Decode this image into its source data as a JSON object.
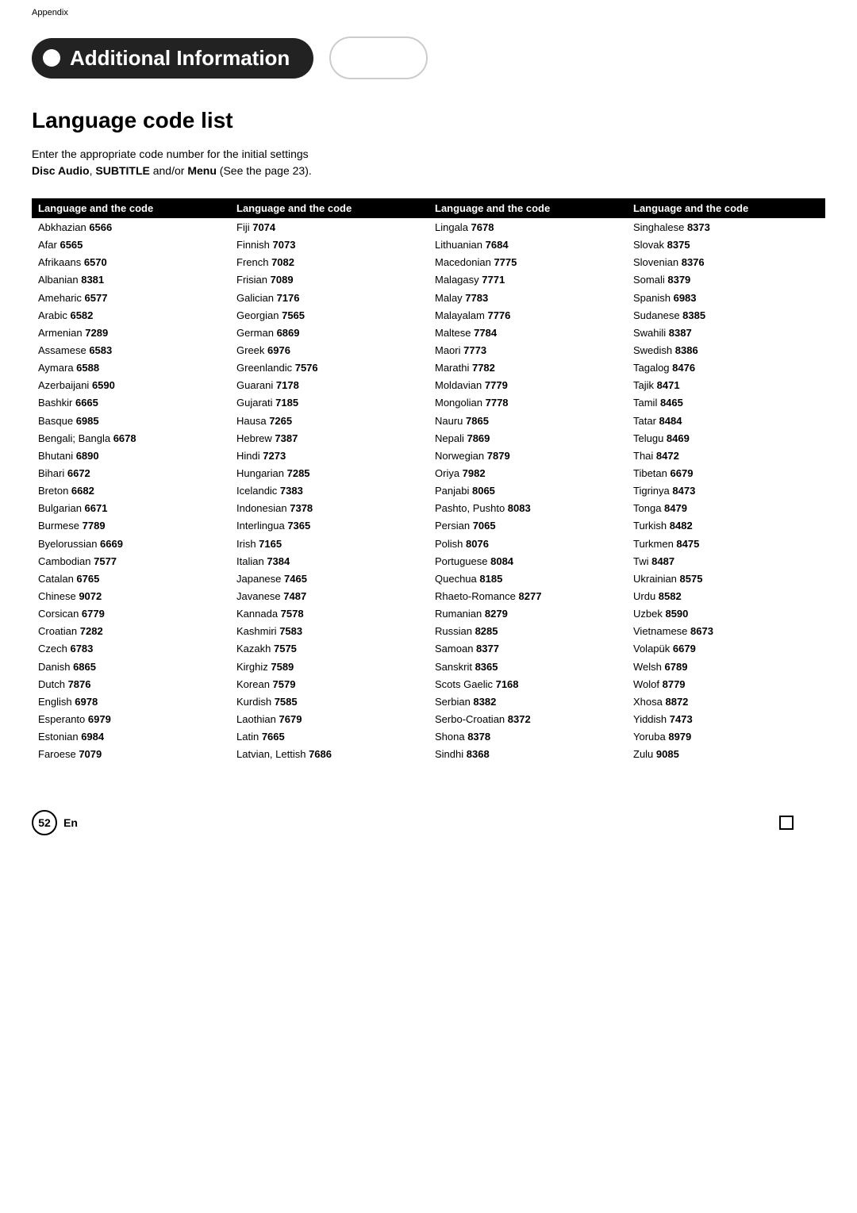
{
  "header": {
    "appendix": "Appendix",
    "title": "Additional Information",
    "page_num": "52",
    "en": "En"
  },
  "page_title": "Language code list",
  "description": "Enter the appropriate code number for the initial settings Disc Audio, SUBTITLE and/or Menu (See the page 23).",
  "table_header": "Language and the code",
  "columns": [
    [
      {
        "lang": "Abkhazian",
        "code": "6566"
      },
      {
        "lang": "Afar",
        "code": "6565"
      },
      {
        "lang": "Afrikaans",
        "code": "6570"
      },
      {
        "lang": "Albanian",
        "code": "8381"
      },
      {
        "lang": "Ameharic",
        "code": "6577"
      },
      {
        "lang": "Arabic",
        "code": "6582"
      },
      {
        "lang": "Armenian",
        "code": "7289"
      },
      {
        "lang": "Assamese",
        "code": "6583"
      },
      {
        "lang": "Aymara",
        "code": "6588"
      },
      {
        "lang": "Azerbaijani",
        "code": "6590"
      },
      {
        "lang": "Bashkir",
        "code": "6665"
      },
      {
        "lang": "Basque",
        "code": "6985"
      },
      {
        "lang": "Bengali; Bangla",
        "code": "6678"
      },
      {
        "lang": "Bhutani",
        "code": "6890"
      },
      {
        "lang": "Bihari",
        "code": "6672"
      },
      {
        "lang": "Breton",
        "code": "6682"
      },
      {
        "lang": "Bulgarian",
        "code": "6671"
      },
      {
        "lang": "Burmese",
        "code": "7789"
      },
      {
        "lang": "Byelorussian",
        "code": "6669"
      },
      {
        "lang": "Cambodian",
        "code": "7577"
      },
      {
        "lang": "Catalan",
        "code": "6765"
      },
      {
        "lang": "Chinese",
        "code": "9072"
      },
      {
        "lang": "Corsican",
        "code": "6779"
      },
      {
        "lang": "Croatian",
        "code": "7282"
      },
      {
        "lang": "Czech",
        "code": "6783"
      },
      {
        "lang": "Danish",
        "code": "6865"
      },
      {
        "lang": "Dutch",
        "code": "7876"
      },
      {
        "lang": "English",
        "code": "6978"
      },
      {
        "lang": "Esperanto",
        "code": "6979"
      },
      {
        "lang": "Estonian",
        "code": "6984"
      },
      {
        "lang": "Faroese",
        "code": "7079"
      }
    ],
    [
      {
        "lang": "Fiji",
        "code": "7074"
      },
      {
        "lang": "Finnish",
        "code": "7073"
      },
      {
        "lang": "French",
        "code": "7082"
      },
      {
        "lang": "Frisian",
        "code": "7089"
      },
      {
        "lang": "Galician",
        "code": "7176"
      },
      {
        "lang": "Georgian",
        "code": "7565"
      },
      {
        "lang": "German",
        "code": "6869"
      },
      {
        "lang": "Greek",
        "code": "6976"
      },
      {
        "lang": "Greenlandic",
        "code": "7576"
      },
      {
        "lang": "Guarani",
        "code": "7178"
      },
      {
        "lang": "Gujarati",
        "code": "7185"
      },
      {
        "lang": "Hausa",
        "code": "7265"
      },
      {
        "lang": "Hebrew",
        "code": "7387"
      },
      {
        "lang": "Hindi",
        "code": "7273"
      },
      {
        "lang": "Hungarian",
        "code": "7285"
      },
      {
        "lang": "Icelandic",
        "code": "7383"
      },
      {
        "lang": "Indonesian",
        "code": "7378"
      },
      {
        "lang": "Interlingua",
        "code": "7365"
      },
      {
        "lang": "Irish",
        "code": "7165"
      },
      {
        "lang": "Italian",
        "code": "7384"
      },
      {
        "lang": "Japanese",
        "code": "7465"
      },
      {
        "lang": "Javanese",
        "code": "7487"
      },
      {
        "lang": "Kannada",
        "code": "7578"
      },
      {
        "lang": "Kashmiri",
        "code": "7583"
      },
      {
        "lang": "Kazakh",
        "code": "7575"
      },
      {
        "lang": "Kirghiz",
        "code": "7589"
      },
      {
        "lang": "Korean",
        "code": "7579"
      },
      {
        "lang": "Kurdish",
        "code": "7585"
      },
      {
        "lang": "Laothian",
        "code": "7679"
      },
      {
        "lang": "Latin",
        "code": "7665"
      },
      {
        "lang": "Latvian, Lettish",
        "code": "7686"
      }
    ],
    [
      {
        "lang": "Lingala",
        "code": "7678"
      },
      {
        "lang": "Lithuanian",
        "code": "7684"
      },
      {
        "lang": "Macedonian",
        "code": "7775"
      },
      {
        "lang": "Malagasy",
        "code": "7771"
      },
      {
        "lang": "Malay",
        "code": "7783"
      },
      {
        "lang": "Malayalam",
        "code": "7776"
      },
      {
        "lang": "Maltese",
        "code": "7784"
      },
      {
        "lang": "Maori",
        "code": "7773"
      },
      {
        "lang": "Marathi",
        "code": "7782"
      },
      {
        "lang": "Moldavian",
        "code": "7779"
      },
      {
        "lang": "Mongolian",
        "code": "7778"
      },
      {
        "lang": "Nauru",
        "code": "7865"
      },
      {
        "lang": "Nepali",
        "code": "7869"
      },
      {
        "lang": "Norwegian",
        "code": "7879"
      },
      {
        "lang": "Oriya",
        "code": "7982"
      },
      {
        "lang": "Panjabi",
        "code": "8065"
      },
      {
        "lang": "Pashto, Pushto",
        "code": "8083"
      },
      {
        "lang": "Persian",
        "code": "7065"
      },
      {
        "lang": "Polish",
        "code": "8076"
      },
      {
        "lang": "Portuguese",
        "code": "8084"
      },
      {
        "lang": "Quechua",
        "code": "8185"
      },
      {
        "lang": "Rhaeto-Romance",
        "code": "8277"
      },
      {
        "lang": "Rumanian",
        "code": "8279"
      },
      {
        "lang": "Russian",
        "code": "8285"
      },
      {
        "lang": "Samoan",
        "code": "8377"
      },
      {
        "lang": "Sanskrit",
        "code": "8365"
      },
      {
        "lang": "Scots Gaelic",
        "code": "7168"
      },
      {
        "lang": "Serbian",
        "code": "8382"
      },
      {
        "lang": "Serbo-Croatian",
        "code": "8372"
      },
      {
        "lang": "Shona",
        "code": "8378"
      },
      {
        "lang": "Sindhi",
        "code": "8368"
      }
    ],
    [
      {
        "lang": "Singhalese",
        "code": "8373"
      },
      {
        "lang": "Slovak",
        "code": "8375"
      },
      {
        "lang": "Slovenian",
        "code": "8376"
      },
      {
        "lang": "Somali",
        "code": "8379"
      },
      {
        "lang": "Spanish",
        "code": "6983"
      },
      {
        "lang": "Sudanese",
        "code": "8385"
      },
      {
        "lang": "Swahili",
        "code": "8387"
      },
      {
        "lang": "Swedish",
        "code": "8386"
      },
      {
        "lang": "Tagalog",
        "code": "8476"
      },
      {
        "lang": "Tajik",
        "code": "8471"
      },
      {
        "lang": "Tamil",
        "code": "8465"
      },
      {
        "lang": "Tatar",
        "code": "8484"
      },
      {
        "lang": "Telugu",
        "code": "8469"
      },
      {
        "lang": "Thai",
        "code": "8472"
      },
      {
        "lang": "Tibetan",
        "code": "6679"
      },
      {
        "lang": "Tigrinya",
        "code": "8473"
      },
      {
        "lang": "Tonga",
        "code": "8479"
      },
      {
        "lang": "Turkish",
        "code": "8482"
      },
      {
        "lang": "Turkmen",
        "code": "8475"
      },
      {
        "lang": "Twi",
        "code": "8487"
      },
      {
        "lang": "Ukrainian",
        "code": "8575"
      },
      {
        "lang": "Urdu",
        "code": "8582"
      },
      {
        "lang": "Uzbek",
        "code": "8590"
      },
      {
        "lang": "Vietnamese",
        "code": "8673"
      },
      {
        "lang": "Volapük",
        "code": "6679"
      },
      {
        "lang": "Welsh",
        "code": "6789"
      },
      {
        "lang": "Wolof",
        "code": "8779"
      },
      {
        "lang": "Xhosa",
        "code": "8872"
      },
      {
        "lang": "Yiddish",
        "code": "7473"
      },
      {
        "lang": "Yoruba",
        "code": "8979"
      },
      {
        "lang": "Zulu",
        "code": "9085"
      }
    ]
  ]
}
